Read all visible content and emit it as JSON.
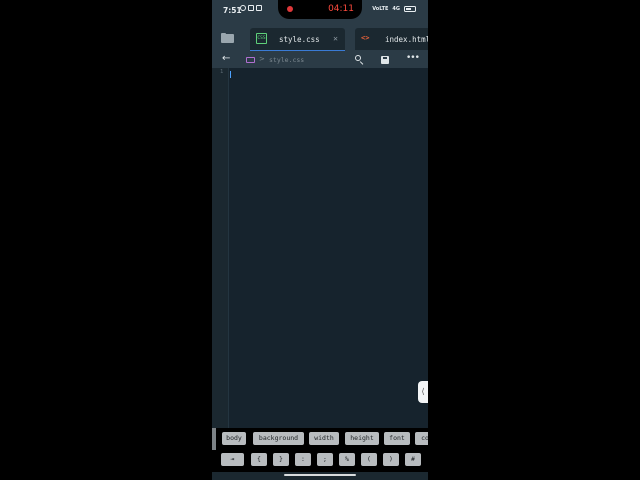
{
  "status_bar": {
    "time": "7:51",
    "recording_time": "04:11",
    "signal_labels": [
      "VoLTE",
      "4G"
    ]
  },
  "tabs": [
    {
      "label": "style.css",
      "icon": "css-file-icon",
      "active": true,
      "close": "✕"
    },
    {
      "label": "index.html",
      "icon": "html-file-icon",
      "active": false
    }
  ],
  "toolbar": {
    "breadcrumb_file": "style.css",
    "breadcrumb_sep": ">"
  },
  "editor": {
    "line_numbers": [
      "1"
    ],
    "content": ""
  },
  "snippets": [
    "body",
    "background",
    "width",
    "height",
    "font",
    "co"
  ],
  "symbols": [
    "⇥",
    "{",
    "}",
    ":",
    ";",
    "%",
    "(",
    ")",
    "#"
  ],
  "colors": {
    "editor_bg": "#16232d",
    "chrome_bg": "#2b3b46",
    "recording": "#ff4b3e",
    "css_icon": "#5ed07a",
    "html_icon": "#e8623a"
  }
}
